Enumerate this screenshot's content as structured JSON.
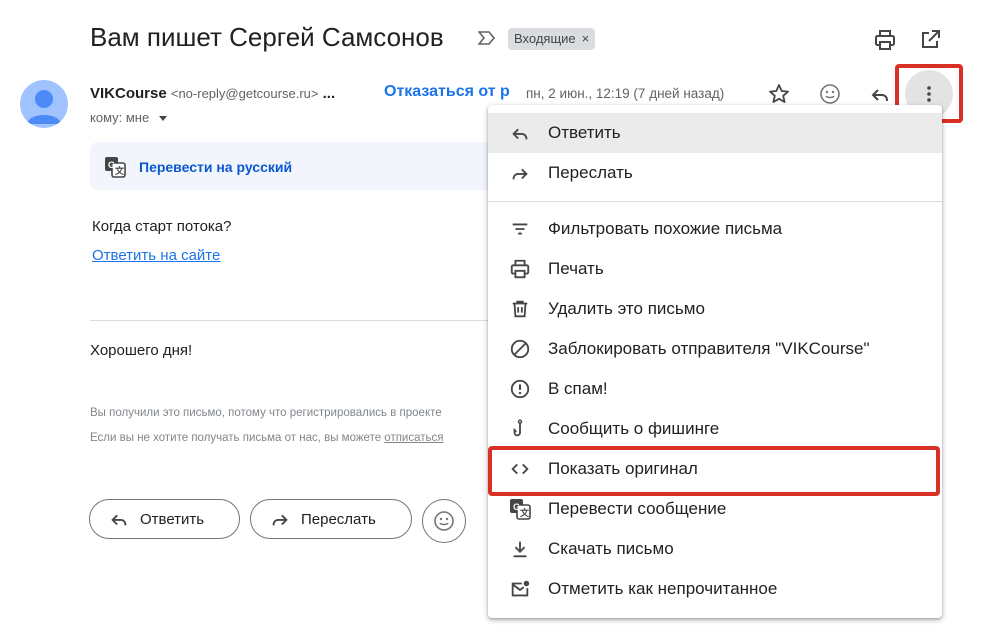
{
  "header": {
    "subject": "Вам пишет Сергей Самсонов",
    "label_chip": "Входящие",
    "label_close": "×"
  },
  "sender": {
    "name": "VIKCourse",
    "email": "<no-reply@getcourse.ru>",
    "ellipsis": "...",
    "unsubscribe": "Отказаться от р",
    "date": "пн, 2 июн., 12:19 (7 дней назад)",
    "to": "кому: мне"
  },
  "translate": {
    "link": "Перевести на русский"
  },
  "body": {
    "question": "Когда старт потока?",
    "reply_link": "Ответить на сайте",
    "regards": "Хорошего дня!",
    "footer_1": "Вы получили это письмо, потому что регистрировались в проекте",
    "footer_2_prefix": "Если вы не хотите получать письма от нас, вы можете ",
    "footer_2_link": "отписаться"
  },
  "actions": {
    "reply": "Ответить",
    "forward": "Переслать"
  },
  "menu": {
    "items": [
      {
        "label": "Ответить",
        "icon": "reply-icon"
      },
      {
        "label": "Переслать",
        "icon": "forward-icon"
      },
      {
        "label": "Фильтровать похожие письма",
        "icon": "filter-icon"
      },
      {
        "label": "Печать",
        "icon": "print-icon"
      },
      {
        "label": "Удалить это письмо",
        "icon": "trash-icon"
      },
      {
        "label": "Заблокировать отправителя \"VIKCourse\"",
        "icon": "block-icon"
      },
      {
        "label": "В спам!",
        "icon": "spam-icon"
      },
      {
        "label": "Сообщить о фишинге",
        "icon": "phishing-icon"
      },
      {
        "label": "Показать оригинал",
        "icon": "code-icon"
      },
      {
        "label": "Перевести сообщение",
        "icon": "translate-icon"
      },
      {
        "label": "Скачать письмо",
        "icon": "download-icon"
      },
      {
        "label": "Отметить как непрочитанное",
        "icon": "mark-unread-icon"
      }
    ]
  },
  "colors": {
    "link": "#1a73e8",
    "highlight_box": "#d93025",
    "menu_hover": "#ebebeb"
  }
}
